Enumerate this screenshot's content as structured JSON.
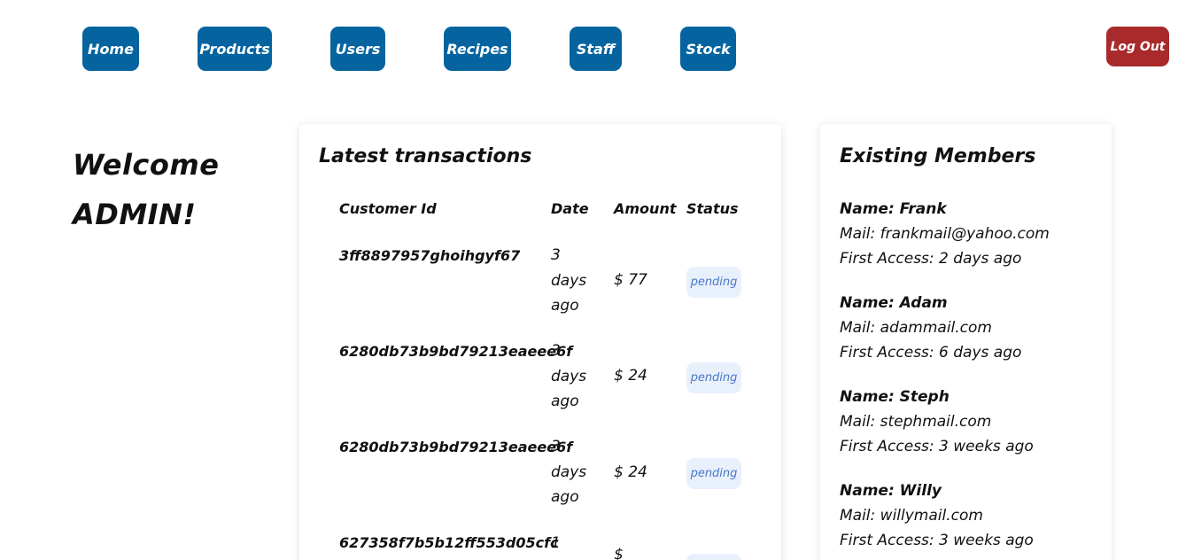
{
  "nav": {
    "home": "Home",
    "products": "Products",
    "users": "Users",
    "recipes": "Recipes",
    "staff": "Staff",
    "stock": "Stock",
    "logout": "Log Out"
  },
  "welcome": {
    "line1": "Welcome",
    "line2": "ADMIN!"
  },
  "transactions": {
    "title": "Latest transactions",
    "headers": {
      "customer_id": "Customer Id",
      "date": "Date",
      "amount": "Amount",
      "status": "Status"
    },
    "rows": [
      {
        "id": "3ff889795­7ghoihgyf67",
        "date": "3 days ago",
        "amount": "$ 77",
        "status": "pending"
      },
      {
        "id": "6280db73b9bd79213eaeee6f",
        "date": "3 days ago",
        "amount": "$ 24",
        "status": "pending"
      },
      {
        "id": "6280db73b9bd79213eaeee6f",
        "date": "3 days ago",
        "amount": "$ 24",
        "status": "pending"
      },
      {
        "id": "627358f7b5b12ff553d05cfc",
        "date": "1",
        "amount": "$",
        "status": ""
      }
    ]
  },
  "members": {
    "title": "Existing Members",
    "list": [
      {
        "name": "Name: Frank",
        "mail": "Mail: frankmail@yahoo.com",
        "access": "First Access: 2 days ago"
      },
      {
        "name": "Name: Adam",
        "mail": "Mail: adammail.com",
        "access": "First Access: 6 days ago"
      },
      {
        "name": "Name: Steph",
        "mail": "Mail: stephmail.com",
        "access": "First Access: 3 weeks ago"
      },
      {
        "name": "Name: Willy",
        "mail": "Mail: willymail.com",
        "access": "First Access: 3 weeks ago"
      }
    ]
  },
  "colors": {
    "nav_bg": "#05649f",
    "logout_bg": "#a82a2a",
    "badge_bg": "#e8f0fc",
    "badge_text": "#4a78c8"
  }
}
